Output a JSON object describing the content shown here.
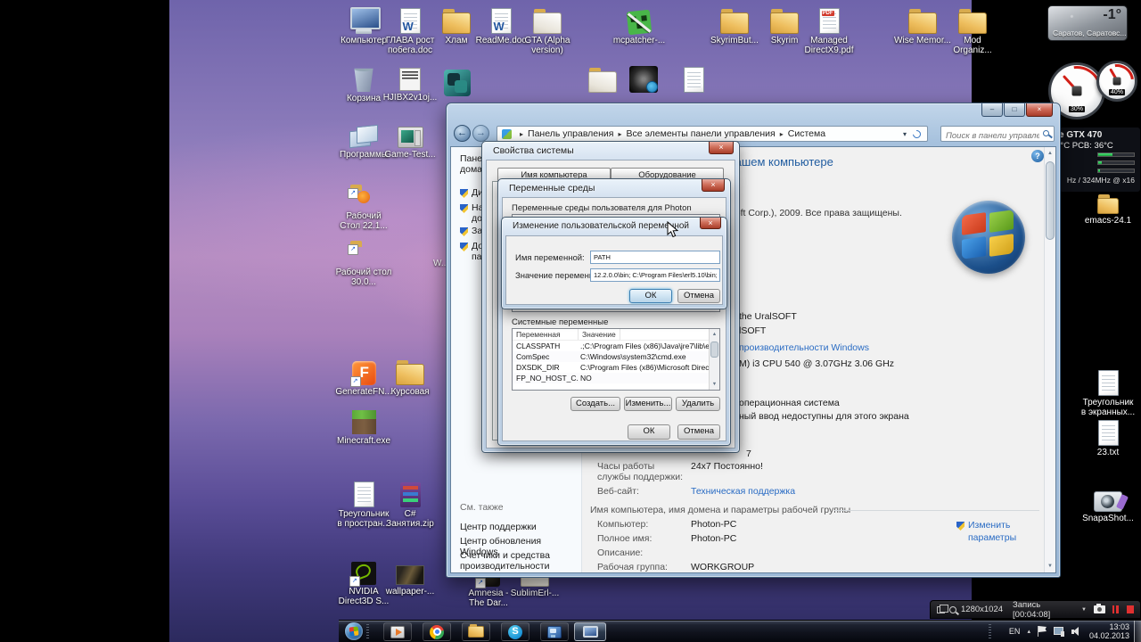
{
  "glyphs": {
    "close": "×",
    "min": "–",
    "max": "□",
    "back": "←",
    "fwd": "→",
    "sep": "▸",
    "dropdown": "▾",
    "up": "▴",
    "scroll_up": "▲",
    "scroll_down": "▼",
    "skype": "S",
    "help": "?"
  },
  "desktop": {
    "icons_top": [
      "Компьютер",
      "ГЛАВА рост побега.doc",
      "Хлам",
      "ReadMe.doc",
      "GTA (Alpha version)",
      "mcpatcher-...",
      "SkyrimBut...",
      "Skyrim",
      "Managed DirectX9.pdf",
      "Wise Memor...",
      "Mod Organiz..."
    ],
    "icons_row2": [
      "Корзина",
      "HJIBX2v1oj..."
    ],
    "icons_left": [
      "Программы",
      "Game-Test...",
      "Рабочий Стол 22.1...",
      "Рабочий стол 30.0...",
      "GenerateFN...",
      "Курсовая",
      "Minecraft.exe",
      "Треугольник в простран...",
      "C# Занятия.zip",
      "NVIDIA Direct3D S...",
      "wallpaper-...",
      "Amnesia - The Dar...",
      "SublimErl-..."
    ],
    "fragment_w": "W...",
    "icons_right": [
      "emacs-24.1",
      "Треугольник в экранных...",
      "23.txt",
      "SnapaShot..."
    ],
    "weather": {
      "temp": "-1°",
      "location": "Саратов, Саратовс..."
    },
    "gauges": [
      "30%",
      "40%"
    ],
    "gpu": {
      "title": "GeForce GTX 470",
      "temps": "GPU: 47°C  PCB: 36°C",
      "rows": [
        "40%",
        "9%",
        "6%"
      ],
      "clock": "Hz / 324MHz @ x16"
    }
  },
  "explorer": {
    "breadcrumb": [
      "Панель управления",
      "Все элементы панели управления",
      "Система"
    ],
    "search_placeholder": "Поиск в панели управления",
    "sidebar": {
      "home": "Панель управления — домашняя страница",
      "items": [
        "Диспетчер устройств",
        "Настройка удаленного доступа",
        "Защита системы",
        "Дополнительные параметры системы"
      ],
      "see_also": "См. также",
      "links": [
        "Центр поддержки",
        "Центр обновления Windows",
        "Счетчики и средства производительности"
      ]
    },
    "content": {
      "title": "Просмотр основных сведений о вашем компьютере",
      "copyright": "© Корпорация Майкрософт (Microsoft Corp.), 2009. Все права защищены.",
      "frag_manufacturer": "the UralSOFT",
      "frag_model": "lSOFT",
      "frag_rating_link": "производительности Windows",
      "frag_cpu": "M) i3 CPU        540  @ 3.07GHz  3.06 GHz",
      "frag_os": "операционная система",
      "frag_pen": "ный ввод недоступны для этого экрана",
      "frag_7": "7",
      "support_hours_label": "Часы работы службы поддержки:",
      "support_hours_value": "24x7 Постоянно!",
      "website_label": "Веб-сайт:",
      "website_link": "Техническая поддержка",
      "group_header": "Имя компьютера, имя домена и параметры рабочей группы",
      "rows": [
        {
          "label": "Компьютер:",
          "value": "Photon-PC"
        },
        {
          "label": "Полное имя:",
          "value": "Photon-PC"
        },
        {
          "label": "Описание:",
          "value": ""
        },
        {
          "label": "Рабочая группа:",
          "value": "WORKGROUP"
        }
      ],
      "change_link_line1": "Изменить",
      "change_link_line2": "параметры"
    }
  },
  "dialogs": {
    "sysprops": {
      "title": "Свойства системы",
      "tabs": [
        "Имя компьютера",
        "Оборудование"
      ]
    },
    "envvars": {
      "title": "Переменные среды",
      "user_group": "Переменные среды пользователя для Photon",
      "system_group": "Системные переменные",
      "col_var": "Переменная",
      "col_val": "Значение",
      "rows": [
        {
          "name": "CLASSPATH",
          "value": ".;C:\\Program Files (x86)\\Java\\jre7\\lib\\e..."
        },
        {
          "name": "ComSpec",
          "value": "C:\\Windows\\system32\\cmd.exe"
        },
        {
          "name": "DXSDK_DIR",
          "value": "C:\\Program Files (x86)\\Microsoft Direct..."
        },
        {
          "name": "FP_NO_HOST_C...",
          "value": "NO"
        }
      ],
      "btn_new": "Создать...",
      "btn_edit": "Изменить...",
      "btn_delete": "Удалить",
      "btn_ok": "ОК",
      "btn_cancel": "Отмена"
    },
    "editvar": {
      "title": "Изменение пользовательской переменной",
      "name_label": "Имя переменной:",
      "name_value": "PATH",
      "value_label": "Значение переменной:",
      "value_value": "12.2.0.0\\bin; C:\\Program Files\\erl5.10\\bin;",
      "btn_ok": "ОК",
      "btn_cancel": "Отмена"
    }
  },
  "recorder": {
    "resolution": "1280x1024",
    "status": "Запись [00:04:08]"
  },
  "taskbar": {
    "lang": "EN",
    "time": "13:03",
    "date": "04.02.2013"
  }
}
